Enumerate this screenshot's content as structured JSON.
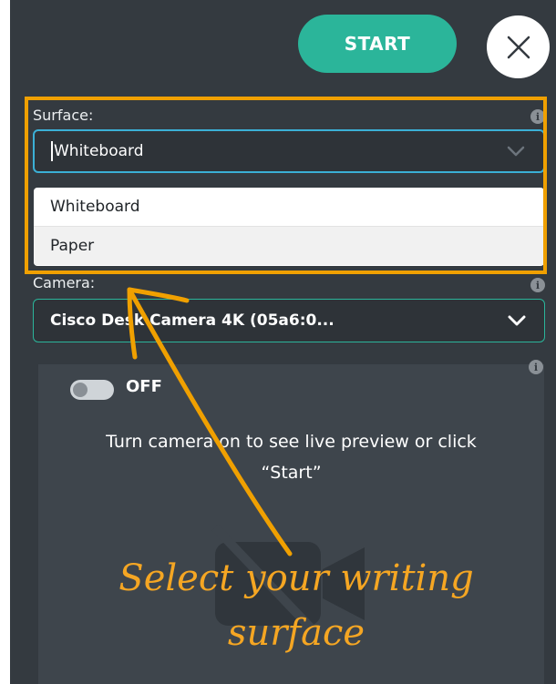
{
  "header": {
    "start_label": "START"
  },
  "surface": {
    "label": "Surface:",
    "selected": "Whiteboard",
    "options": [
      "Whiteboard",
      "Paper"
    ]
  },
  "camera": {
    "label": "Camera:",
    "selected": "Cisco Desk Camera 4K (05a6:0..."
  },
  "preview": {
    "toggle_state": "OFF",
    "message_line1": "Turn camera on to see live preview or click",
    "message_line2": "“Start”"
  },
  "annotation": {
    "line1": "Select your writing",
    "line2": "surface"
  },
  "colors": {
    "panel_bg": "#343a40",
    "start_green": "#2bb59a",
    "focus_blue": "#3bb0d6",
    "annotation_orange": "#f0a000"
  },
  "icons": {
    "close": "close-icon",
    "info": "info-icon",
    "chevron": "chevron-down-icon",
    "camera_off": "camera-off-icon"
  }
}
